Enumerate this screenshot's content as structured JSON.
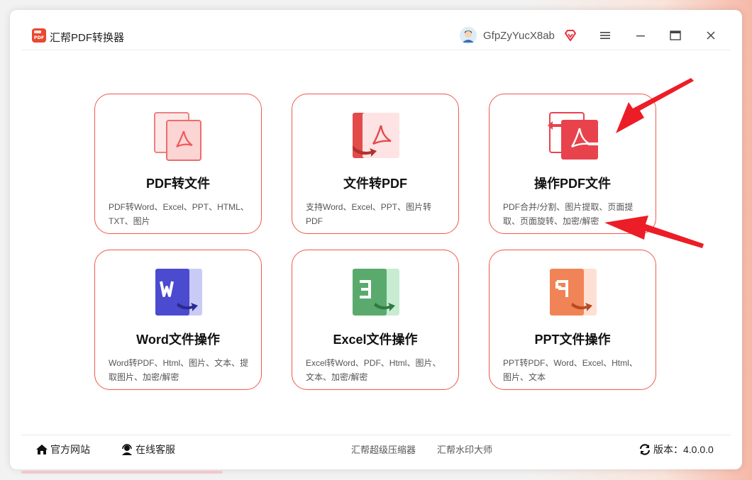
{
  "app": {
    "title": "汇帮PDF转换器",
    "logo_text": "PDF",
    "brand_color": "#e8492f"
  },
  "user": {
    "name": "GfpZyYucX8ab"
  },
  "cards": [
    {
      "title": "PDF转文件",
      "desc": "PDF转Word、Excel、PPT、HTML、TXT、图片",
      "icon": "pdf-to-file-icon",
      "color": "#f07a7a"
    },
    {
      "title": "文件转PDF",
      "desc": "支持Word、Excel、PPT、图片转PDF",
      "icon": "file-to-pdf-icon",
      "color": "#e34b4b"
    },
    {
      "title": "操作PDF文件",
      "desc": "PDF合并/分割、图片提取、页面提取、页面旋转、加密/解密",
      "icon": "operate-pdf-icon",
      "color": "#e8434d"
    },
    {
      "title": "Word文件操作",
      "desc": "Word转PDF、Html、图片、文本、提取图片、加密/解密",
      "icon": "word-icon",
      "color": "#4b4bcf"
    },
    {
      "title": "Excel文件操作",
      "desc": "Excel转Word、PDF、Html、图片、文本、加密/解密",
      "icon": "excel-icon",
      "color": "#5aaa6e"
    },
    {
      "title": "PPT文件操作",
      "desc": "PPT转PDF、Word、Excel、Html、图片、文本",
      "icon": "ppt-icon",
      "color": "#f08457"
    }
  ],
  "footer": {
    "website": "官方网站",
    "support": "在线客服",
    "link1": "汇帮超级压缩器",
    "link2": "汇帮水印大师",
    "version": "版本：4.0.0.0"
  }
}
